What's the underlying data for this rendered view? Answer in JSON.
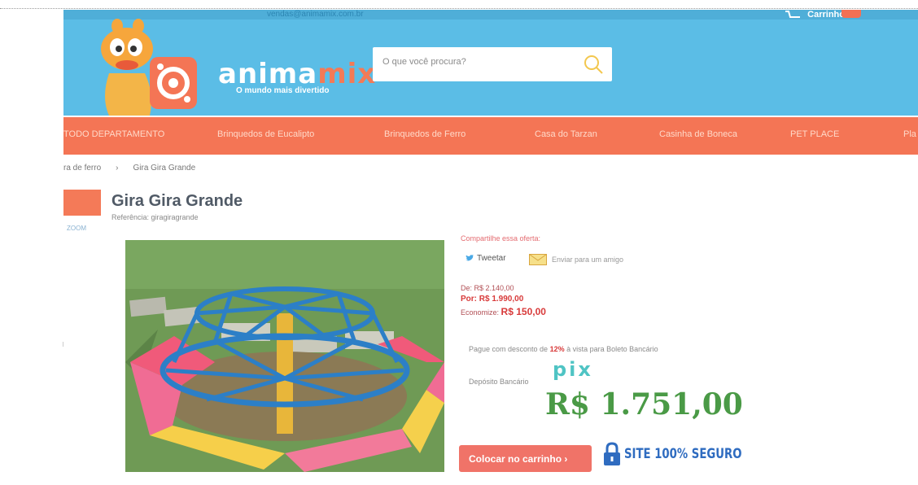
{
  "header": {
    "phone_text": "vendas@animamix.com.br",
    "cart_label": "Carrinho",
    "logo_part1": "anima",
    "logo_part2": "mix",
    "logo_tagline": "O mundo mais divertido"
  },
  "search": {
    "placeholder": "O que você procura?"
  },
  "nav": {
    "items": [
      "TODO DEPARTAMENTO",
      "Brinquedos de Eucalipto",
      "Brinquedos de Ferro",
      "Casa do Tarzan",
      "Casinha de Boneca",
      "PET PLACE",
      "Pla"
    ]
  },
  "breadcrumb": {
    "parent": "ra de ferro",
    "separator": "›",
    "current": "Gira Gira Grande"
  },
  "product": {
    "title": "Gira Gira Grande",
    "reference": "Referência: giragiragrande",
    "side_link": "ZOOM",
    "share_label": "Compartilhe essa oferta:",
    "tweet_label": "Tweetar",
    "mail_label": "Enviar para um amigo",
    "price_old": "De: R$ 2.140,00",
    "price_new": "Por: R$ 1.990,00",
    "save_label": "Economize:",
    "save_value": "R$ 150,00",
    "discount_prefix": "Pague com desconto de ",
    "discount_pct": "12%",
    "discount_suffix": " à vista para Boleto Bancário",
    "deposit_label": "Depósito Bancário",
    "pix_label": "pix",
    "big_price": "R$ 1.751,00",
    "buy_button": "Colocar no carrinho ›",
    "secure_label": "SITE 100% SEGURO"
  },
  "colors": {
    "header_bg": "#5bbde6",
    "nav_bg": "#f47555",
    "price_red": "#d83a3a",
    "pix_teal": "#4fc4c4",
    "big_price_green": "#4a9a46",
    "buy_button_bg": "#f07368",
    "secure_blue": "#2f6cc0"
  }
}
